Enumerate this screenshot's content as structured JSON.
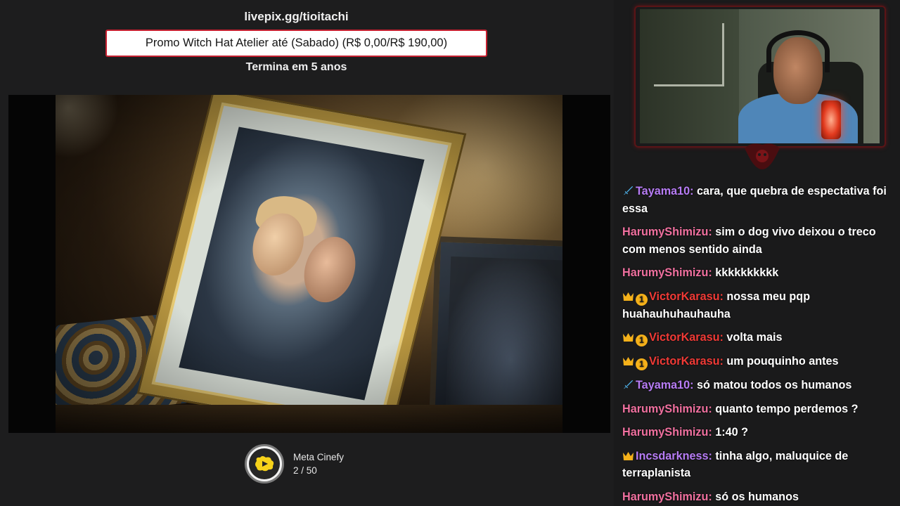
{
  "promo": {
    "url": "livepix.gg/tioitachi",
    "goal": "Promo Witch Hat Atelier até (Sabado) (R$ 0,00/R$ 190,00)",
    "ends": "Termina em 5 anos",
    "border_color": "#c62030"
  },
  "meta": {
    "title": "Meta Cinefy",
    "current": 2,
    "target": 50,
    "progress_text": "2 / 50",
    "icon": "cinefy-play-icon"
  },
  "chat": [
    {
      "badges": [
        "sword"
      ],
      "user": "Tayama10:",
      "color": "#b77cf5",
      "text": "cara, que quebra de espectativa foi essa"
    },
    {
      "badges": [],
      "user": "HarumyShimizu:",
      "color": "#f0709f",
      "text": "sim o dog vivo deixou o treco com menos sentido ainda"
    },
    {
      "badges": [],
      "user": "HarumyShimizu:",
      "color": "#f0709f",
      "text": "kkkkkkkkkk"
    },
    {
      "badges": [
        "crown",
        "one"
      ],
      "user": "VictorKarasu:",
      "color": "#f03a36",
      "text": "nossa meu pqp huahauhuhauhauha"
    },
    {
      "badges": [
        "crown",
        "one"
      ],
      "user": "VictorKarasu:",
      "color": "#f03a36",
      "text": "volta mais"
    },
    {
      "badges": [
        "crown",
        "one"
      ],
      "user": "VictorKarasu:",
      "color": "#f03a36",
      "text": "um pouquinho antes"
    },
    {
      "badges": [
        "sword"
      ],
      "user": "Tayama10:",
      "color": "#b77cf5",
      "text": "só matou todos os humanos"
    },
    {
      "badges": [],
      "user": "HarumyShimizu:",
      "color": "#f0709f",
      "text": "quanto tempo perdemos ?"
    },
    {
      "badges": [],
      "user": "HarumyShimizu:",
      "color": "#f0709f",
      "text": "1:40 ?"
    },
    {
      "badges": [
        "crown"
      ],
      "user": "Incsdarkness:",
      "color": "#b77cf5",
      "text": "tinha algo, maluquice de terraplanista"
    },
    {
      "badges": [],
      "user": "HarumyShimizu:",
      "color": "#f0709f",
      "text": "só os humanos"
    }
  ],
  "badge_colors": {
    "crown": "#f5b11a",
    "one": "#f5b11a",
    "sword": "#4fb6f0"
  }
}
